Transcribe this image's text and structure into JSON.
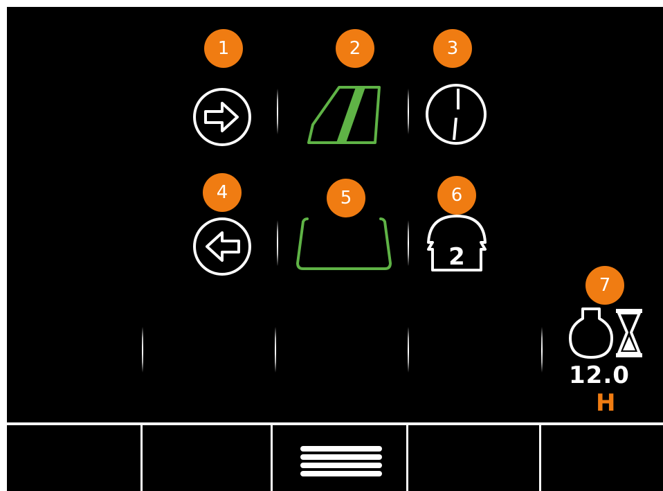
{
  "badges": {
    "b1": "1",
    "b2": "2",
    "b3": "3",
    "b4": "4",
    "b5": "5",
    "b6": "6",
    "b7": "7"
  },
  "icons": {
    "direction_right": "arrow-right-circle-icon",
    "front_window": "front-window-icon",
    "clock": "clock-icon",
    "direction_left": "arrow-left-circle-icon",
    "rear_window": "rear-window-icon",
    "light_two": "light-level-2-icon",
    "engine_timer": "engine-hourglass-icon",
    "menu": "menu-icon"
  },
  "light_level": "2",
  "timer": {
    "value": "12.0",
    "unit": "H"
  },
  "colors": {
    "accent": "#f07c12",
    "active": "#5fb346",
    "foreground": "#ffffff",
    "background": "#000000"
  }
}
